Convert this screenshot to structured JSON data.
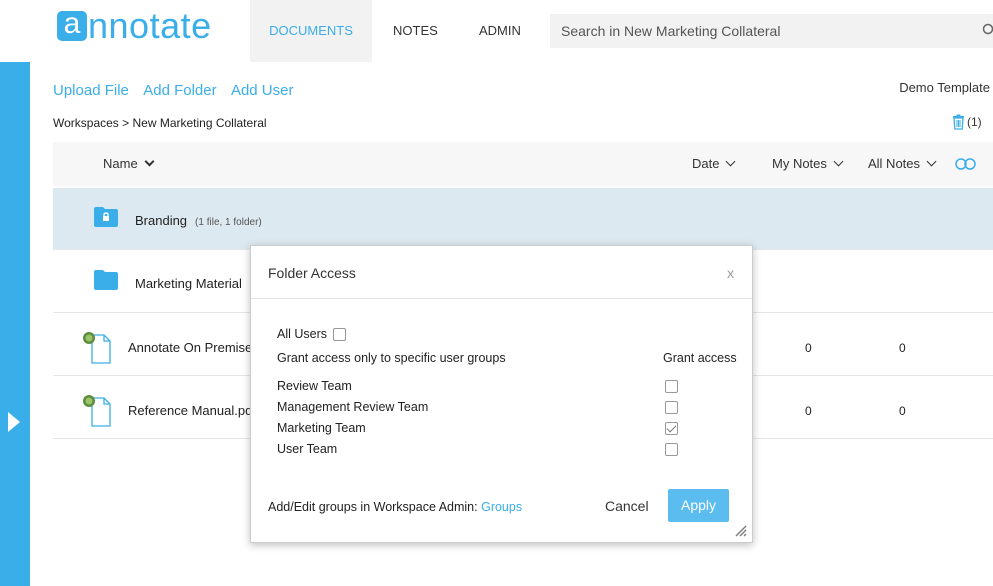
{
  "app": {
    "logo_letter": "a",
    "logo_text": "nnotate",
    "brand_color": "#3aaee8"
  },
  "nav": {
    "tabs": [
      {
        "label": "DOCUMENTS",
        "active": true
      },
      {
        "label": "NOTES",
        "active": false
      },
      {
        "label": "ADMIN",
        "active": false
      }
    ]
  },
  "search": {
    "placeholder": "Search in New Marketing Collateral",
    "icon": "search-icon"
  },
  "actions": {
    "upload_file": "Upload File",
    "add_folder": "Add Folder",
    "add_user": "Add User"
  },
  "template_label": "Demo Template",
  "breadcrumb": "Workspaces > New Marketing Collateral",
  "trash": {
    "count": "(1)",
    "icon": "trash-icon"
  },
  "table": {
    "columns": {
      "name": "Name",
      "date": "Date",
      "my_notes": "My Notes",
      "all_notes": "All Notes"
    },
    "rows": [
      {
        "type": "folder",
        "name": "Branding",
        "sub": "(1 file, 1 folder)",
        "locked": true,
        "selected": true
      },
      {
        "type": "folder",
        "name": "Marketing Material",
        "sub": "",
        "locked": false,
        "selected": false
      },
      {
        "type": "file",
        "name": "Annotate On Premise",
        "my_notes": "0",
        "all_notes": "0"
      },
      {
        "type": "file",
        "name": "Reference Manual.pd",
        "my_notes": "0",
        "all_notes": "0"
      }
    ]
  },
  "dialog": {
    "title": "Folder Access",
    "close": "x",
    "all_users_label": "All Users",
    "all_users_checked": false,
    "specific_label": "Grant access only to specific user groups",
    "grant_header": "Grant access",
    "groups": [
      {
        "name": "Review Team",
        "checked": false
      },
      {
        "name": "Management Review Team",
        "checked": false
      },
      {
        "name": "Marketing Team",
        "checked": true
      },
      {
        "name": "User Team",
        "checked": false
      }
    ],
    "footer_text": "Add/Edit groups in Workspace Admin:",
    "footer_link": "Groups",
    "cancel": "Cancel",
    "apply": "Apply"
  }
}
